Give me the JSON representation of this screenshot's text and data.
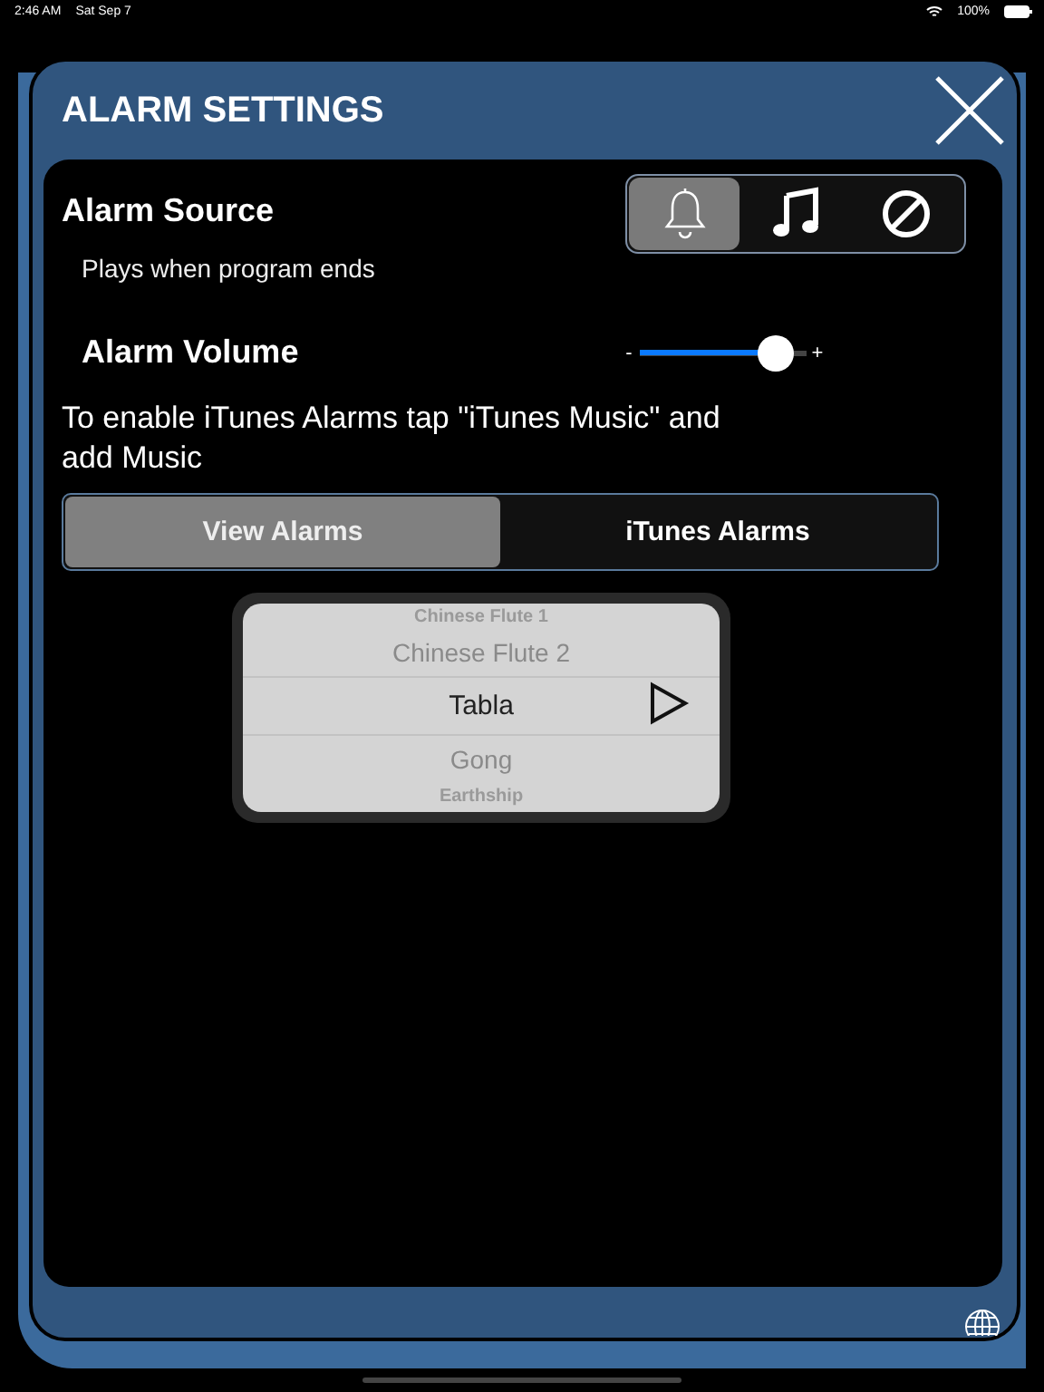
{
  "status_bar": {
    "time": "2:46 AM",
    "date": "Sat Sep 7",
    "battery": "100%"
  },
  "dialog": {
    "title": "ALARM SETTINGS"
  },
  "alarm_source": {
    "label": "Alarm Source",
    "description": "Plays when program ends",
    "options": [
      {
        "kind": "bell",
        "selected": true
      },
      {
        "kind": "note",
        "selected": false
      },
      {
        "kind": "none",
        "selected": false
      }
    ]
  },
  "alarm_volume": {
    "label": "Alarm Volume",
    "minus": "-",
    "plus": "+",
    "level": 0.9
  },
  "hint": "To enable iTunes Alarms tap \"iTunes Music\" and add Music",
  "tabs": [
    {
      "label": "View Alarms",
      "selected": true
    },
    {
      "label": "iTunes Alarms",
      "selected": false
    }
  ],
  "picker": {
    "items": [
      {
        "label": "Chinese Flute 1",
        "selected": false
      },
      {
        "label": "Chinese Flute 2",
        "selected": false
      },
      {
        "label": "Tabla",
        "selected": true
      },
      {
        "label": "Gong",
        "selected": false
      },
      {
        "label": "Earthship",
        "selected": false
      }
    ]
  }
}
